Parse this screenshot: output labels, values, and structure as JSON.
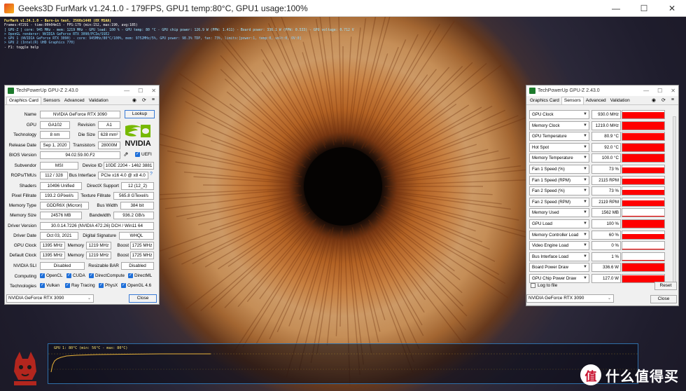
{
  "furmark": {
    "title": "Geeks3D FurMark v1.24.1.0 - 179FPS, GPU1 temp:80°C, GPU1 usage:100%",
    "overlay_lines": [
      "FurMark v1.24.1.0 - Burn-in test, 2560x1440 (8X MSAA)",
      "Frames:47291 - time:00h04m15 - FPS:179 (min:152, max:190, avg:185)",
      "[ GPU-Z ] core: 945 MHz - mem: 1219 MHz - GPU load: 100 % - GPU temp: 80 °C - GPU chip power: 126.9 W (PPW: 1.411) - Board power: 336.1 W (PPW: 0.533) - GPU voltage: 0.712 V",
      "> OpenGL renderer: NVIDIA GeForce RTX 3090/PCIe/SSE2",
      "> GPU 1 (NVIDIA GeForce RTX 3090) - core: 945MHz/80°C/100%, mem: 9752MHz/5%, GPU power: 98.3% TDP, fan: 73%, limits:[power:1, temp:0, volt:0, OV:0]",
      "> GPU 2 (Intel(R) UHD Graphics 770)",
      "- F1: toggle help"
    ],
    "graph_label": "GPU 1: 80°C (min: 56°C - max: 80°C)"
  },
  "gpuz_left": {
    "title": "TechPowerUp GPU-Z 2.43.0",
    "tabs": [
      "Graphics Card",
      "Sensors",
      "Advanced",
      "Validation"
    ],
    "name_label": "Name",
    "name": "NVIDIA GeForce RTX 3090",
    "lookup": "Lookup",
    "gpu_label": "GPU",
    "gpu": "GA102",
    "revision_label": "Revision",
    "revision": "A1",
    "technology_label": "Technology",
    "technology": "8 nm",
    "die_size_label": "Die Size",
    "die_size": "628 mm²",
    "release_label": "Release Date",
    "release": "Sep 1, 2020",
    "transistors_label": "Transistors",
    "transistors": "28000M",
    "bios_label": "BIOS Version",
    "bios": "94.02.59.00.F2",
    "uefi": "UEFI",
    "subvendor_label": "Subvendor",
    "subvendor": "MSI",
    "device_id_label": "Device ID",
    "device_id": "10DE 2204 - 1462 3881",
    "rops_label": "ROPs/TMUs",
    "rops": "112 / 328",
    "bus_label": "Bus Interface",
    "bus": "PCIe x16 4.0 @ x8 4.0",
    "shaders_label": "Shaders",
    "shaders": "10496 Unified",
    "directx_label": "DirectX Support",
    "directx": "12 (12_2)",
    "pixel_label": "Pixel Fillrate",
    "pixel": "193.2 GPixel/s",
    "texture_label": "Texture Fillrate",
    "texture": "565.8 GTexel/s",
    "memtype_label": "Memory Type",
    "memtype": "GDDR6X (Micron)",
    "buswidth_label": "Bus Width",
    "buswidth": "384 bit",
    "memsize_label": "Memory Size",
    "memsize": "24576 MB",
    "bandwidth_label": "Bandwidth",
    "bandwidth": "936.2 GB/s",
    "driver_label": "Driver Version",
    "driver": "30.0.14.7226 (NVIDIA 472.26) DCH / Win11 64",
    "driverdate_label": "Driver Date",
    "driverdate": "Oct 03, 2021",
    "digsig_label": "Digital Signature",
    "digsig": "WHQL",
    "gpuclock_label": "GPU Clock",
    "gpuclock": "1395 MHz",
    "memory_label": "Memory",
    "memclock": "1219 MHz",
    "boost_label": "Boost",
    "boost": "1725 MHz",
    "defclock_label": "Default Clock",
    "defclock": "1395 MHz",
    "defmem": "1219 MHz",
    "defboost": "1725 MHz",
    "sli_label": "NVIDIA SLI",
    "sli": "Disabled",
    "rebar_label": "Resizable BAR",
    "rebar": "Disabled",
    "computing_label": "Computing",
    "computing": [
      "OpenCL",
      "CUDA",
      "DirectCompute",
      "DirectML"
    ],
    "technologies_label": "Technologies",
    "technologies": [
      "Vulkan",
      "Ray Tracing",
      "PhysX",
      "OpenGL 4.6"
    ],
    "card_select": "NVIDIA GeForce RTX 3090",
    "close": "Close"
  },
  "gpuz_right": {
    "title": "TechPowerUp GPU-Z 2.43.0",
    "tabs": [
      "Graphics Card",
      "Sensors",
      "Advanced",
      "Validation"
    ],
    "sensors": [
      {
        "name": "GPU Clock",
        "value": "930.0 MHz",
        "level": 0.85
      },
      {
        "name": "Memory Clock",
        "value": "1219.0 MHz",
        "level": 1.0
      },
      {
        "name": "GPU Temperature",
        "value": "80.9 °C",
        "level": 0.9
      },
      {
        "name": "Hot Spot",
        "value": "92.0 °C",
        "level": 0.95
      },
      {
        "name": "Memory Temperature",
        "value": "100.0 °C",
        "level": 1.0
      },
      {
        "name": "Fan 1 Speed (%)",
        "value": "73 %",
        "level": 0.7
      },
      {
        "name": "Fan 1 Speed (RPM)",
        "value": "2115 RPM",
        "level": 0.7
      },
      {
        "name": "Fan 2 Speed (%)",
        "value": "73 %",
        "level": 0.7
      },
      {
        "name": "Fan 2 Speed (RPM)",
        "value": "2119 RPM",
        "level": 0.7
      },
      {
        "name": "Memory Used",
        "value": "1562 MB",
        "level": 0.08
      },
      {
        "name": "GPU Load",
        "value": "100 %",
        "level": 1.0
      },
      {
        "name": "Memory Controller Load",
        "value": "60 %",
        "level": 0.6
      },
      {
        "name": "Video Engine Load",
        "value": "0 %",
        "level": 0.0
      },
      {
        "name": "Bus Interface Load",
        "value": "1 %",
        "level": 0.01
      },
      {
        "name": "Board Power Draw",
        "value": "336.6 W",
        "level": 1.0
      },
      {
        "name": "GPU Chip Power Draw",
        "value": "127.0 W",
        "level": 0.95
      }
    ],
    "log_to_file": "Log to file",
    "reset": "Reset",
    "card_select": "NVIDIA GeForce RTX 3090",
    "close": "Close"
  },
  "watermark": {
    "badge": "值",
    "text": "什么值得买"
  },
  "colors": {
    "sensor_bar": "#ff0000",
    "checkbox": "#1e6fd9",
    "nvidia_green": "#76b900"
  }
}
